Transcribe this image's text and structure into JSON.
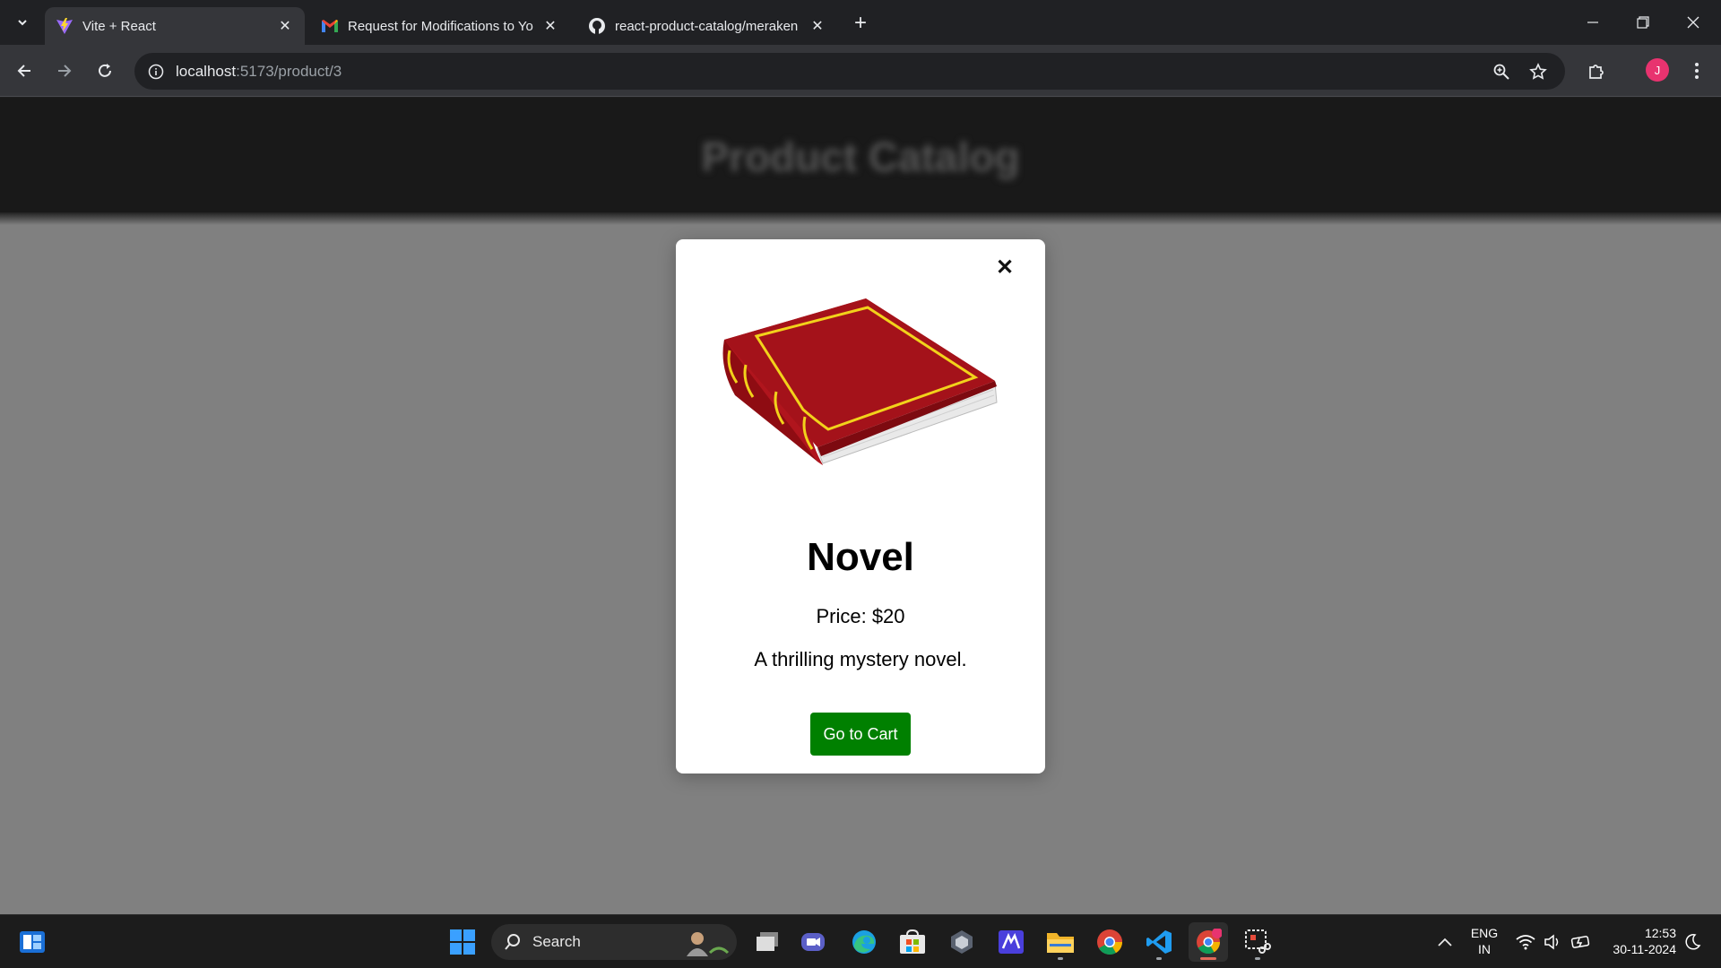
{
  "browser": {
    "tabs": [
      {
        "title": "Vite + React",
        "favicon": "vite-icon",
        "active": true
      },
      {
        "title": "Request for Modifications to Yo",
        "favicon": "gmail-icon",
        "active": false
      },
      {
        "title": "react-product-catalog/meraken",
        "favicon": "github-icon",
        "active": false
      }
    ],
    "url_host": "localhost",
    "url_path": ":5173/product/3",
    "profile_initial": "J"
  },
  "page": {
    "header_title": "Product Catalog"
  },
  "modal": {
    "close_glyph": "✕",
    "product_name": "Novel",
    "price": "Price: $20",
    "description": "A thrilling mystery novel.",
    "cart_button": "Go to Cart"
  },
  "taskbar": {
    "search_label": "Search",
    "language_line1": "ENG",
    "language_line2": "IN",
    "time": "12:53",
    "date": "30-11-2024"
  },
  "colors": {
    "cart_button": "#008000",
    "overlay": "#808080",
    "header": "#191919"
  }
}
